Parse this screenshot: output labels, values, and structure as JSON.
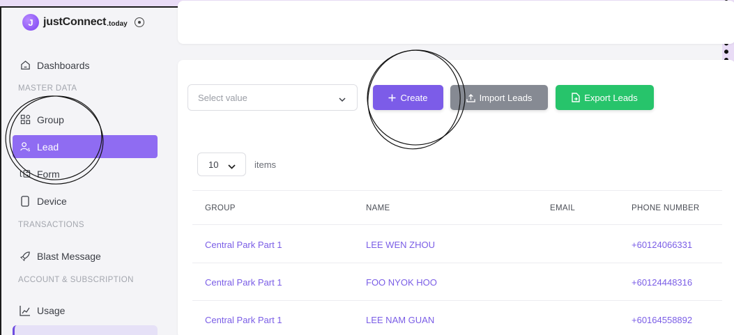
{
  "brand": {
    "logo_letter": "J",
    "name": "justConnect",
    "suffix": ".today",
    "accent": "#7b42f2"
  },
  "sidebar": {
    "items": [
      {
        "label": "Dashboards",
        "icon": "home-icon"
      },
      {
        "label": "Group",
        "icon": "grid-icon"
      },
      {
        "label": "Lead",
        "icon": "user-dollar-icon",
        "active": true
      },
      {
        "label": "Form",
        "icon": "form-cursor-icon"
      },
      {
        "label": "Device",
        "icon": "phone-device-icon"
      },
      {
        "label": "Blast Message",
        "icon": "rocket-icon"
      },
      {
        "label": "Usage",
        "icon": "chart-usage-icon"
      }
    ],
    "sections": [
      "MASTER DATA",
      "TRANSACTIONS",
      "ACCOUNT & SUBSCRIPTION"
    ],
    "active_color": "#8f6cf2"
  },
  "toolbar": {
    "select_placeholder": "Select value",
    "create_label": "Create",
    "import_label": "Import Leads",
    "export_label": "Export Leads",
    "create_color": "#7c5ce8",
    "import_color": "#868a93",
    "export_color": "#27c46b"
  },
  "pager": {
    "page_size": "10",
    "items_label": "items"
  },
  "table": {
    "columns": [
      "GROUP",
      "NAME",
      "EMAIL",
      "PHONE NUMBER"
    ],
    "rows": [
      {
        "group": "Central Park Part 1",
        "name": "LEE WEN ZHOU",
        "email": "",
        "phone": "+60124066331"
      },
      {
        "group": "Central Park Part 1",
        "name": "FOO NYOK HOO",
        "email": "",
        "phone": "+60124448316"
      },
      {
        "group": "Central Park Part 1",
        "name": "LEE NAM GUAN",
        "email": "",
        "phone": "+60164558892"
      }
    ]
  }
}
